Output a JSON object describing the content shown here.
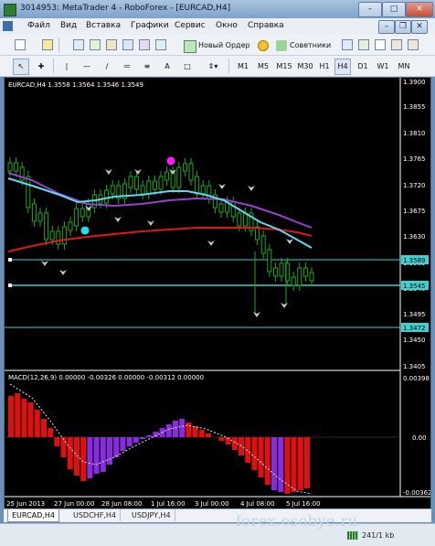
{
  "window": {
    "title": "3014953: MetaTrader 4 - RoboForex - [EURCAD,H4]"
  },
  "menu": [
    "Файл",
    "Вид",
    "Вставка",
    "Графики",
    "Сервис",
    "Окно",
    "Справка"
  ],
  "toolbar": {
    "new_order": "Новый Ордер",
    "advisors": "Советники",
    "timeframes": [
      "M1",
      "M5",
      "M15",
      "M30",
      "H1",
      "H4",
      "D1",
      "W1",
      "MN"
    ],
    "active_timeframe": "H4"
  },
  "chart": {
    "info": "EURCAD,H4  1.3558 1.3564 1.3546 1.3549",
    "price_ticks": [
      "1.3900",
      "1.3855",
      "1.3810",
      "1.3765",
      "1.3720",
      "1.3675",
      "1.3630",
      "1.3585",
      "1.3540",
      "1.3495",
      "1.3450",
      "1.3405"
    ],
    "hlines": [
      "1.3589",
      "1.3545",
      "1.3472"
    ],
    "time_ticks": [
      "25 Jun 2013",
      "27 Jun 00:00",
      "28 Jun 08:00",
      "1 Jul 16:00",
      "3 Jul 00:00",
      "4 Jul 08:00",
      "5 Jul 16:00"
    ],
    "macd_info": "MACD(12,26,9) 0.00000 -0.00326 0.00000 -0.00312 0.00000",
    "macd_ticks": [
      "0.00398",
      "0.00",
      "-0.00362"
    ]
  },
  "tabs": [
    "EURCAD,H4",
    "USDCHF,H4",
    "USDJPY,H4"
  ],
  "status": {
    "traffic": "241/1 kb",
    "watermark": "forex.osobye.ru"
  },
  "colors": {
    "background": "#000000",
    "level_line": "#40d0d0",
    "ma_cyan": "#60d8f0",
    "ma_purple": "#9a40d0",
    "ma_red": "#e01818",
    "candles": "#1fa81f",
    "macd_red": "#e01010",
    "macd_violet": "#8a2be2"
  }
}
